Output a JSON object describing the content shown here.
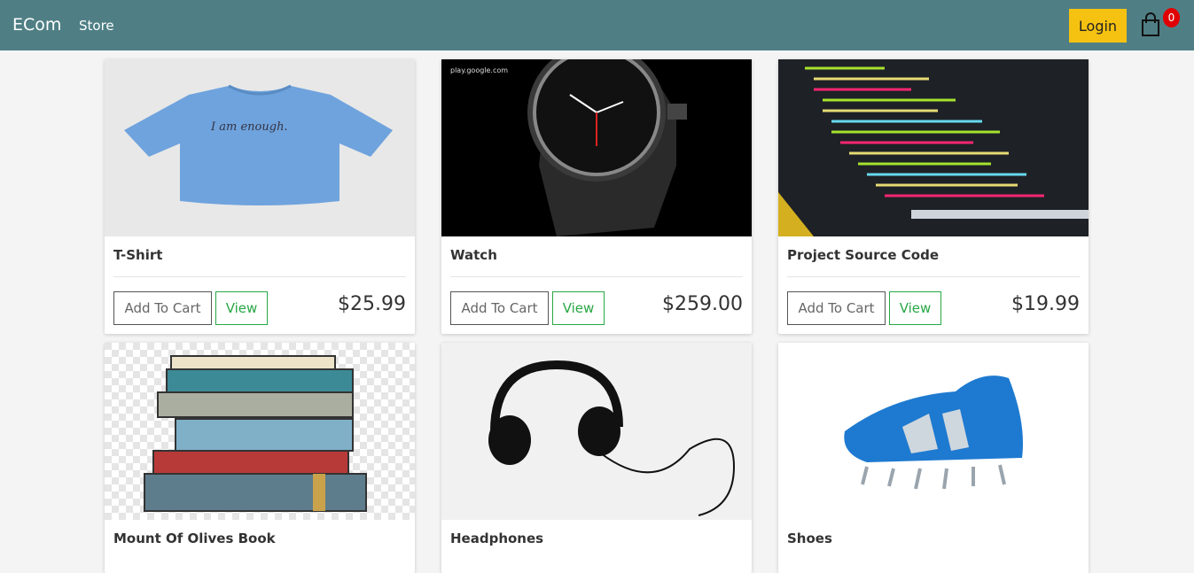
{
  "navbar": {
    "brand": "ECom",
    "store_link": "Store",
    "login_label": "Login",
    "cart_count": "0",
    "bg_color": "#4f7f85",
    "login_color": "#f5c211"
  },
  "products": [
    {
      "title": "T-Shirt",
      "price": "$25.99",
      "add_label": "Add To Cart",
      "view_label": "View",
      "image": "blue-tshirt"
    },
    {
      "title": "Watch",
      "price": "$259.00",
      "add_label": "Add To Cart",
      "view_label": "View",
      "image": "smartwatch",
      "image_caption": "play.google.com"
    },
    {
      "title": "Project Source Code",
      "price": "$19.99",
      "add_label": "Add To Cart",
      "view_label": "View",
      "image": "code-laptop"
    },
    {
      "title": "Mount Of Olives Book",
      "image": "book-stack"
    },
    {
      "title": "Headphones",
      "image": "headphones"
    },
    {
      "title": "Shoes",
      "image": "blue-sneaker"
    }
  ]
}
